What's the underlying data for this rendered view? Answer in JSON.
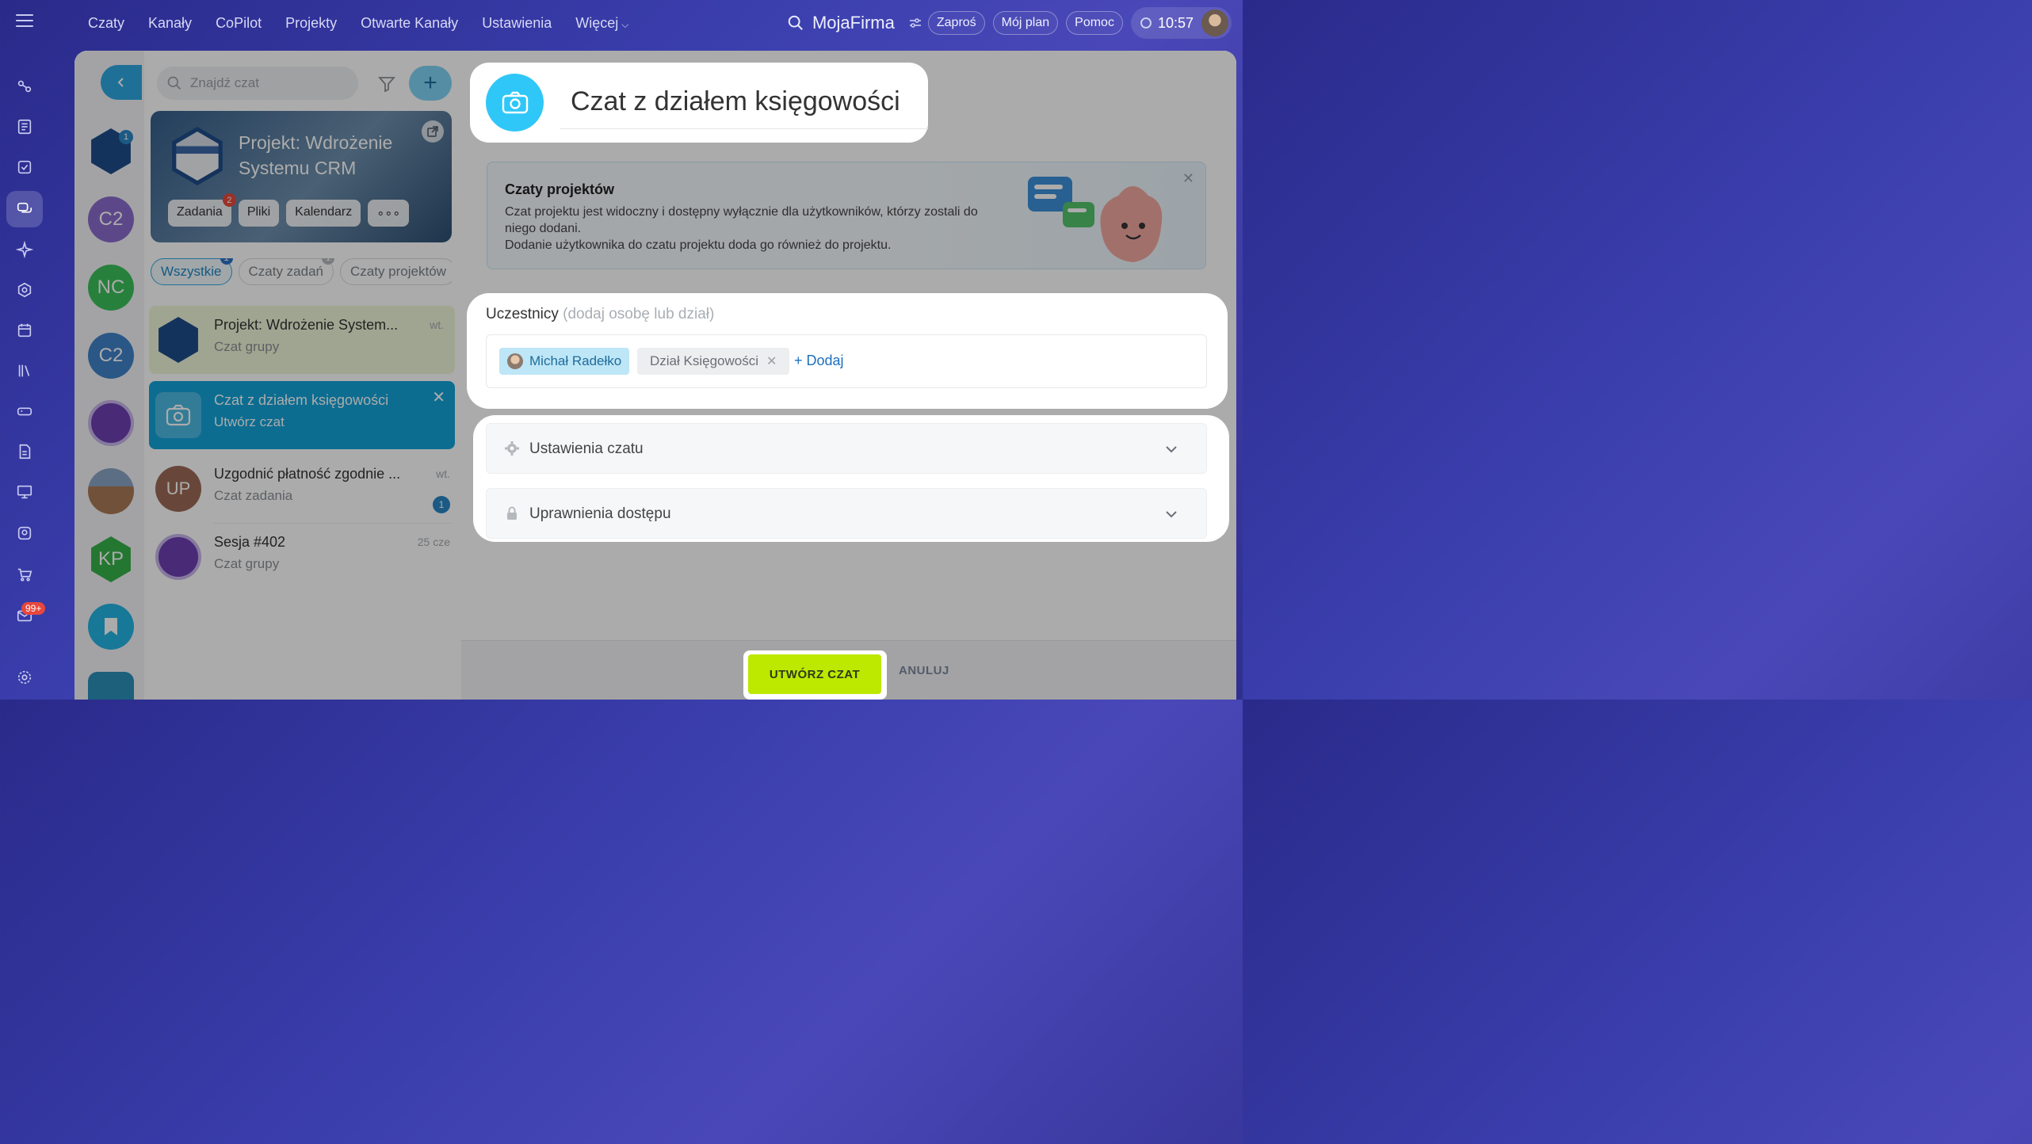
{
  "topbar": {
    "nav": [
      "Czaty",
      "Kanały",
      "CoPilot",
      "Projekty",
      "Otwarte Kanały",
      "Ustawienia",
      "Więcej"
    ],
    "brand": "MojaFirma",
    "invite": "Zaproś",
    "plan": "Mój plan",
    "help": "Pomoc",
    "time": "10:57"
  },
  "rail": {
    "mail_badge": "99+"
  },
  "avatars": {
    "c2a": "C2",
    "nc": "NC",
    "c2b": "C2",
    "kp": "KP",
    "first_badge": "1"
  },
  "list": {
    "search_placeholder": "Znajdź czat",
    "project": {
      "title": "Projekt: Wdrożenie Systemu CRM",
      "chips": [
        "Zadania",
        "Pliki",
        "Kalendarz"
      ],
      "tasks_badge": "2"
    },
    "tabs": [
      {
        "label": "Wszystkie",
        "badge": "1"
      },
      {
        "label": "Czaty zadań",
        "badge": "1"
      },
      {
        "label": "Czaty projektów",
        "badge": ""
      }
    ],
    "rows": [
      {
        "title": "Projekt: Wdrożenie System...",
        "sub": "Czat grupy",
        "date": "wt."
      },
      {
        "title": "Czat z działem księgowości",
        "sub": "Utwórz czat",
        "date": ""
      },
      {
        "title": "Uzgodnić płatność zgodnie ...",
        "sub": "Czat zadania",
        "date": "wt.",
        "badge": "1",
        "initials": "UP"
      },
      {
        "title": "Sesja #402",
        "sub": "Czat grupy",
        "date": "25 cze"
      }
    ]
  },
  "hero": {
    "chat_name": "Czat z działem księgowości"
  },
  "banner": {
    "title": "Czaty projektów",
    "text1": "Czat projektu jest widoczny i dostępny wyłącznie dla użytkowników, którzy zostali do niego dodani.",
    "text2": "Dodanie użytkownika do czatu projektu doda go również do projektu."
  },
  "members": {
    "label": "Uczestnicy",
    "hint": "(dodaj osobę lub dział)",
    "person": "Michał Radełko",
    "department": "Dział Księgowości",
    "add": "+ Dodaj"
  },
  "settings": {
    "chat_settings": "Ustawienia czatu",
    "access": "Uprawnienia dostępu"
  },
  "footer": {
    "create": "UTWÓRZ CZAT",
    "cancel": "ANULUJ"
  },
  "colors": {
    "accent": "#2fa8e0",
    "create_btn": "#bde800",
    "selected_row": "#12a3d9"
  }
}
